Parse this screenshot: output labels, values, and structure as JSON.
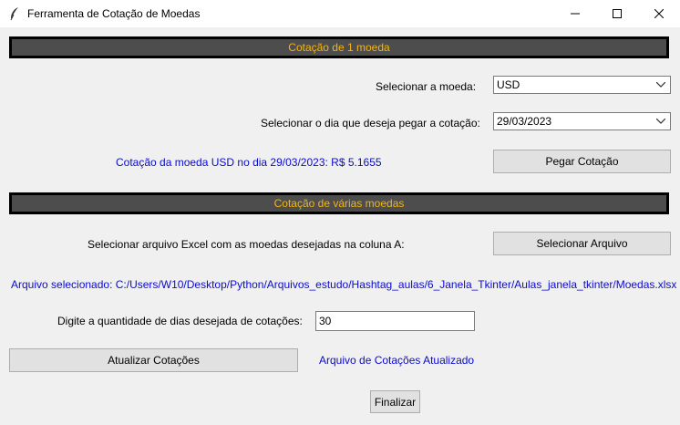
{
  "window": {
    "title": "Ferramenta de Cotação de Moedas",
    "icon": "feather-icon",
    "controls": [
      "minimize-icon",
      "maximize-icon",
      "close-icon"
    ]
  },
  "section1": {
    "header": "Cotação de 1 moeda",
    "currency_label": "Selecionar a moeda:",
    "currency_value": "USD",
    "date_label": "Selecionar o dia que deseja pegar a cotação:",
    "date_value": "29/03/2023",
    "result_text": "Cotação da moeda USD no dia 29/03/2023: R$ 5.1655",
    "button": "Pegar Cotação"
  },
  "section2": {
    "header": "Cotação de várias moedas",
    "file_label": "Selecionar arquivo Excel com as moedas desejadas na coluna A:",
    "file_button": "Selecionar Arquivo",
    "selected_file": "Arquivo selecionado: C:/Users/W10/Desktop/Python/Arquivos_estudo/Hashtag_aulas/6_Janela_Tkinter/Aulas_janela_tkinter/Moedas.xlsx",
    "days_label": "Digite a quantidade de dias desejada de cotações:",
    "days_value": "30",
    "update_button": "Atualizar Cotações",
    "update_status": "Arquivo de Cotações Atualizado"
  },
  "finish_button": "Finalizar",
  "colors": {
    "header_bg": "#4d4d4d",
    "header_text": "#f2b515",
    "status_text": "#0b0bd0",
    "window_bg": "#f0f0f0"
  }
}
